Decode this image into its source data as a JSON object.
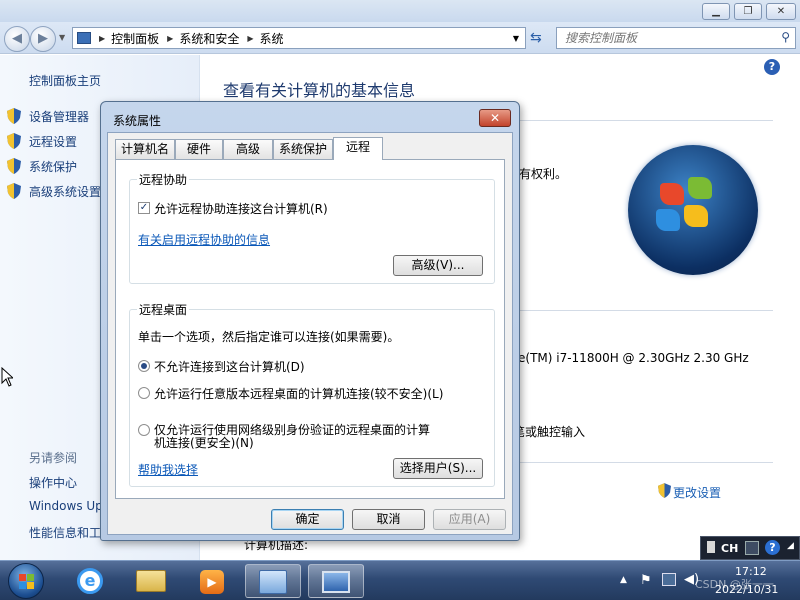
{
  "address": {
    "crumbs": [
      "控制面板",
      "系统和安全",
      "系统"
    ]
  },
  "search": {
    "placeholder": "搜索控制面板"
  },
  "sidebar": {
    "home": "控制面板主页",
    "items": [
      {
        "label": "设备管理器"
      },
      {
        "label": "远程设置"
      },
      {
        "label": "系统保护"
      },
      {
        "label": "高级系统设置"
      }
    ],
    "see_also_title": "另请参阅",
    "see_also": [
      "操作中心",
      "Windows Up",
      "性能信息和工"
    ]
  },
  "main": {
    "title": "查看有关计算机的基本信息",
    "fragments": {
      "rights": "有权利。",
      "processor": "e(TM) i7-11800H @ 2.30GHz   2.30 GHz",
      "touch": "笔或触控输入",
      "change_settings": "更改设置",
      "computer_desc": "计算机描述:"
    }
  },
  "dialog": {
    "title": "系统属性",
    "tabs": [
      "计算机名",
      "硬件",
      "高级",
      "系统保护",
      "远程"
    ],
    "active_tab": "远程",
    "remote_assistance": {
      "group_label": "远程协助",
      "checkbox_label": "允许远程协助连接这台计算机(R)",
      "checked": true,
      "info_link": "有关启用远程协助的信息",
      "advanced_button": "高级(V)..."
    },
    "remote_desktop": {
      "group_label": "远程桌面",
      "instruction": "单击一个选项，然后指定谁可以连接(如果需要)。",
      "options": [
        {
          "label": "不允许连接到这台计算机(D)",
          "selected": true
        },
        {
          "label": "允许运行任意版本远程桌面的计算机连接(较不安全)(L)",
          "selected": false
        },
        {
          "label_line1": "仅允许运行使用网络级别身份验证的远程桌面的计算",
          "label_line2": "机连接(更安全)(N)",
          "selected": false
        }
      ],
      "help_link": "帮助我选择",
      "select_users_button": "选择用户(S)..."
    },
    "buttons": {
      "ok": "确定",
      "cancel": "取消",
      "apply": "应用(A)"
    }
  },
  "language_bar": {
    "label": "CH"
  },
  "taskbar": {
    "apps": [
      "internet-explorer",
      "windows-explorer",
      "media-player",
      "control-panel",
      "system-properties"
    ]
  },
  "clock": {
    "time": "17:12",
    "date": "2022/10/31"
  },
  "watermark": "CSDN @张一一"
}
